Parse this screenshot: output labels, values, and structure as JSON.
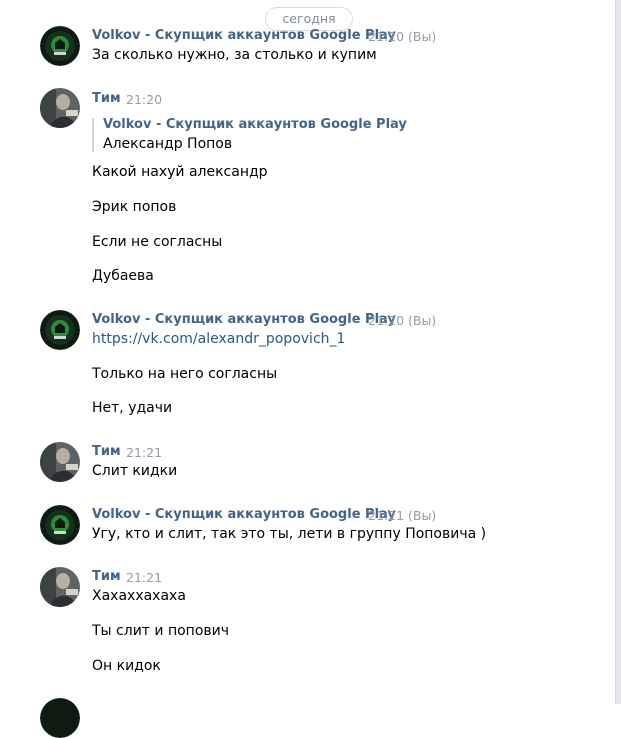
{
  "date_divider": "сегодня",
  "sender_volkov": "Volkov - Скупщик аккаунтов Google Play",
  "sender_tim": "Тим",
  "messages": [
    {
      "time": "21:20 (Вы)",
      "lines": [
        "За сколько нужно, за столько и купим"
      ]
    },
    {
      "time": "21:20",
      "reply": {
        "author": "Volkov - Скупщик аккаунтов Google Play",
        "text": "Александр Попов"
      },
      "lines": [
        "Какой нахуй александр",
        "Эрик попов",
        "Если не согласны",
        "Дубаева"
      ]
    },
    {
      "time": "21:20 (Вы)",
      "link": "https://vk.com/alexandr_popovich_1",
      "lines": [
        "Только на него согласны",
        "Нет, удачи"
      ]
    },
    {
      "time": "21:21",
      "lines": [
        "Слит кидки"
      ]
    },
    {
      "time": "21:21 (Вы)",
      "lines": [
        "Угу, кто и слит, так это ты, лети в группу Поповича )"
      ]
    },
    {
      "time": "21:21",
      "lines": [
        "Хахаххахаха",
        "Ты слит и попович",
        "Он кидок"
      ]
    }
  ],
  "colors": {
    "name": "#42648b",
    "time": "#939ca8",
    "link": "#2a5885",
    "quote_bar": "#cdd5de"
  },
  "icons": {
    "volkov_avatar": "green-logo-avatar-icon",
    "tim_avatar": "person-photo-avatar-icon"
  }
}
